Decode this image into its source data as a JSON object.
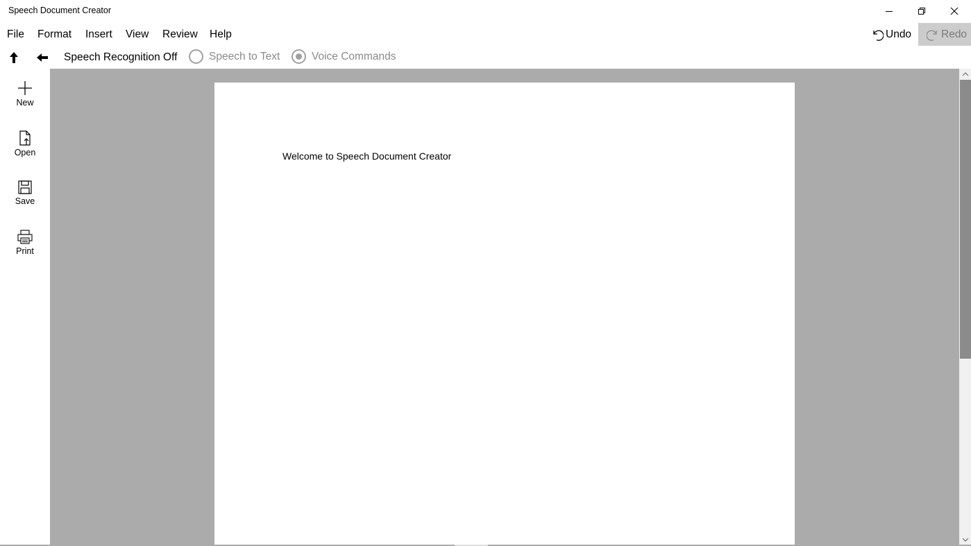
{
  "window": {
    "title": "Speech Document Creator",
    "controls": {
      "minimize_icon": "minimize-icon",
      "restore_icon": "restore-icon",
      "close_icon": "close-icon"
    }
  },
  "menu": {
    "items": [
      "File",
      "Format",
      "Insert",
      "View",
      "Review",
      "Help"
    ]
  },
  "history": {
    "undo_label": "Undo",
    "redo_label": "Redo",
    "redo_enabled": false
  },
  "toolbar": {
    "up_icon": "arrow-up-icon",
    "back_icon": "arrow-left-icon",
    "speech_status": "Speech Recognition Off",
    "modes": [
      {
        "label": "Speech to Text",
        "selected": false
      },
      {
        "label": "Voice Commands",
        "selected": true
      }
    ]
  },
  "sidebar": {
    "items": [
      {
        "label": "New",
        "icon": "plus-icon"
      },
      {
        "label": "Open",
        "icon": "open-file-icon"
      },
      {
        "label": "Save",
        "icon": "floppy-disk-icon"
      },
      {
        "label": "Print",
        "icon": "printer-icon"
      }
    ]
  },
  "document": {
    "text": "Welcome to Speech Document Creator"
  },
  "colors": {
    "workspace_bg": "#ababab",
    "page_bg": "#ffffff",
    "disabled_text": "#8a8a8a",
    "redo_bg": "#cccccc",
    "scroll_thumb": "#8b8b8b"
  }
}
